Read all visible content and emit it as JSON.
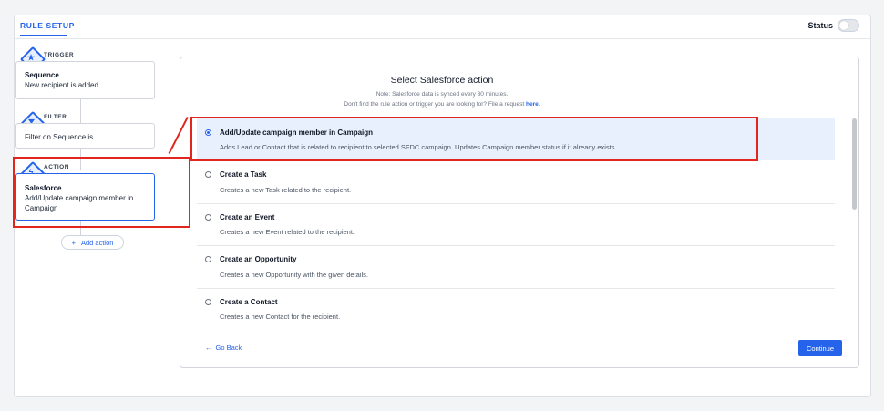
{
  "header": {
    "title": "RULE SETUP",
    "status_label": "Status"
  },
  "steps": [
    {
      "label": "TRIGGER",
      "icon": "star-icon",
      "title": "Sequence",
      "desc": "New recipient is added"
    },
    {
      "label": "FILTER",
      "icon": "filter-icon",
      "title": "",
      "desc": "Filter on Sequence is"
    },
    {
      "label": "ACTION",
      "icon": "lightning-icon",
      "title": "Salesforce",
      "desc": "Add/Update campaign member in Campaign"
    }
  ],
  "add_action": {
    "plus": "+",
    "label": "Add action"
  },
  "panel": {
    "title": "Select Salesforce action",
    "note1": "Note: Salesforce data is synced every 30 minutes.",
    "note2": "Don't find the rule action or trigger you are looking for? File a request",
    "note2_link": "here",
    "note2_end": "."
  },
  "options": [
    {
      "title": "Add/Update campaign member in Campaign",
      "desc": "Adds Lead or Contact that is related to recipient to selected SFDC campaign. Updates Campaign member status if it already exists.",
      "selected": true
    },
    {
      "title": "Create a Task",
      "desc": "Creates a new Task related to the recipient.",
      "selected": false
    },
    {
      "title": "Create an Event",
      "desc": "Creates a new Event related to the recipient.",
      "selected": false
    },
    {
      "title": "Create an Opportunity",
      "desc": "Creates a new Opportunity with the given details.",
      "selected": false
    },
    {
      "title": "Create a Contact",
      "desc": "Creates a new Contact for the recipient.",
      "selected": false
    }
  ],
  "footer": {
    "back_arrow": "←",
    "back_label": "Go Back",
    "continue_label": "Continue"
  },
  "colors": {
    "accent": "#2563eb",
    "highlight": "#e0261d",
    "selected_bg": "#e8f0fd"
  }
}
